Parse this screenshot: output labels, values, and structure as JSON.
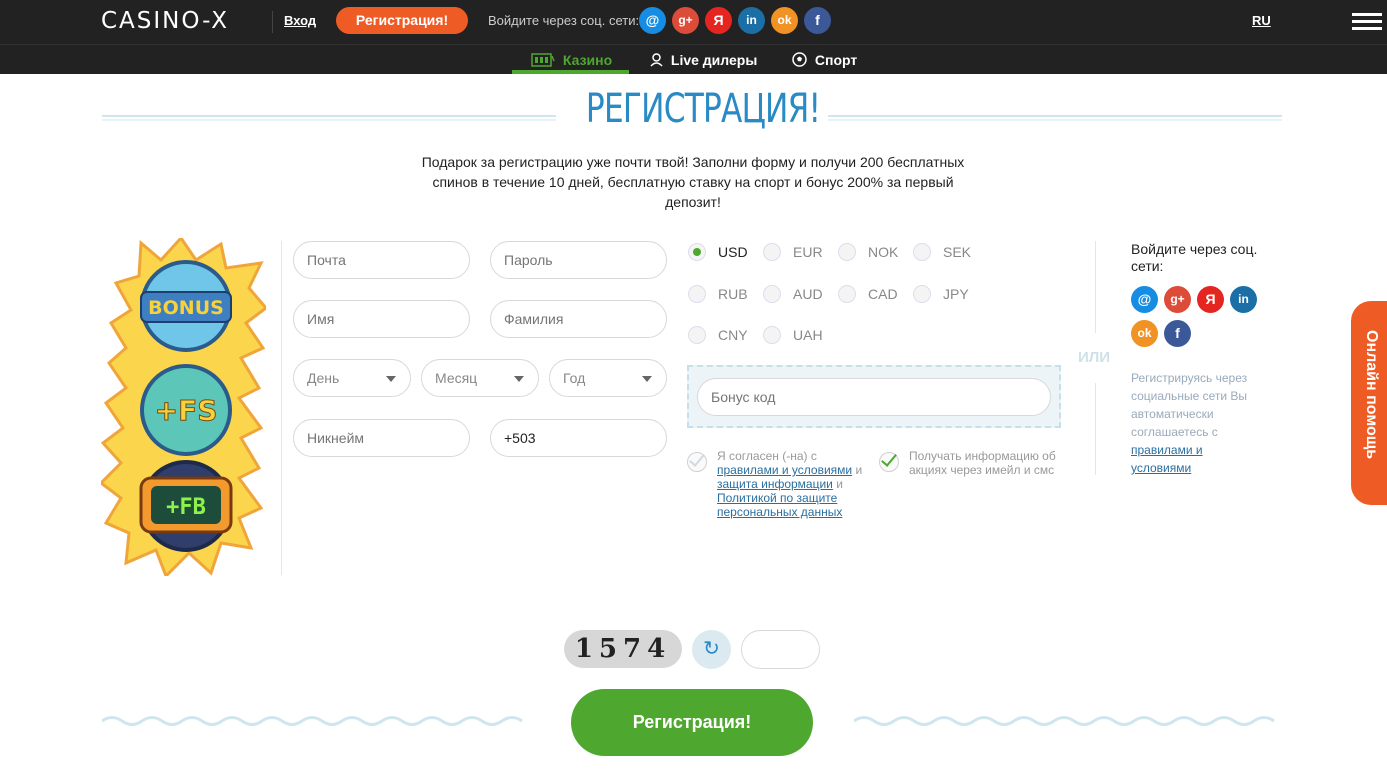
{
  "header": {
    "logo": "CASINO-X",
    "login_label": "Вход",
    "register_label": "Регистрация!",
    "social_label": "Войдите через соц. сети:",
    "social_icons": [
      {
        "name": "mail-icon",
        "glyph": "@",
        "color": "#168de2"
      },
      {
        "name": "google-plus-icon",
        "glyph": "g+",
        "color": "#dd4b39"
      },
      {
        "name": "yandex-icon",
        "glyph": "Я",
        "color": "#e52620"
      },
      {
        "name": "linkedin-icon",
        "glyph": "in",
        "color": "#1b6fa6"
      },
      {
        "name": "odnoklassniki-icon",
        "glyph": "ok",
        "color": "#f09224"
      },
      {
        "name": "facebook-icon",
        "glyph": "f",
        "color": "#3b5998"
      }
    ],
    "lang": "RU"
  },
  "nav": {
    "items": [
      {
        "label": "Казино",
        "icon": "slot-machine-icon",
        "active": true
      },
      {
        "label": "Live дилеры",
        "icon": "dealer-icon",
        "active": false
      },
      {
        "label": "Спорт",
        "icon": "soccer-ball-icon",
        "active": false
      }
    ]
  },
  "page": {
    "title": "РЕГИСТРАЦИЯ!",
    "intro": "Подарок за регистрацию уже почти твой! Заполни форму и получи 200 бесплатных спинов в течение 10 дней, бесплатную ставку на спорт и бонус 200% за первый депозит!"
  },
  "promo": {
    "badges": [
      "BONUS",
      "+FS",
      "+FB"
    ]
  },
  "form": {
    "email_placeholder": "Почта",
    "password_placeholder": "Пароль",
    "first_name_placeholder": "Имя",
    "last_name_placeholder": "Фамилия",
    "day_label": "День",
    "month_label": "Месяц",
    "year_label": "Год",
    "nickname_placeholder": "Никнейм",
    "phone_value": "+503",
    "bonus_code_placeholder": "Бонус код"
  },
  "currencies": {
    "selected": "USD",
    "options": [
      "USD",
      "EUR",
      "NOK",
      "SEK",
      "RUB",
      "AUD",
      "CAD",
      "JPY",
      "CNY",
      "UAH"
    ]
  },
  "terms": {
    "agree_prefix": "Я согласен (-на) с",
    "rules_link": "правилами и условиями",
    "and1": "и",
    "privacy_link": "защита информации",
    "and2": "и",
    "policy_link": "Политикой по защите персональных данных",
    "newsletter": "Получать информацию об акциях через имейл и смс"
  },
  "social_panel": {
    "or": "ИЛИ",
    "title": "Войдите через соц. сети:",
    "note": "Регистрируясь через социальные сети Вы автоматически соглашаетесь с",
    "note_link": "правилами и условиями"
  },
  "captcha": {
    "code": "1574",
    "refresh_icon": "refresh-icon"
  },
  "submit_label": "Регистрация!",
  "help_tab": "Онлайн помощь",
  "colors": {
    "brand_green": "#4ea72e",
    "brand_orange": "#ef5b25",
    "title_blue": "#2a8ac5",
    "header_dark": "#222222"
  }
}
